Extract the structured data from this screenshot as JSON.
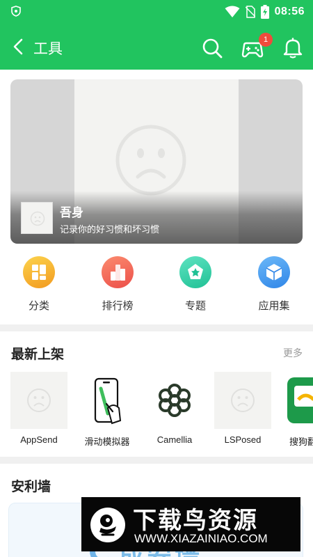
{
  "status_bar": {
    "time": "08:56",
    "icons": [
      "shield-icon",
      "wifi-icon",
      "no-sim-icon",
      "battery-charging-icon"
    ]
  },
  "app_bar": {
    "title": "工具",
    "icons": [
      "back-arrow-icon",
      "search-icon",
      "gamepad-icon",
      "bell-icon"
    ],
    "notification_count": "1"
  },
  "colors": {
    "brand_green": "#21c45f",
    "badge_red": "#ef4b3c"
  },
  "banner": {
    "app_name": "吾身",
    "description": "记录你的好习惯和坏习惯"
  },
  "quick_nav": {
    "items": [
      {
        "label": "分类",
        "icon": "category-icon",
        "color": "#f5b12c"
      },
      {
        "label": "排行榜",
        "icon": "ranking-icon",
        "color": "#f2665a"
      },
      {
        "label": "专题",
        "icon": "topic-star-icon",
        "color": "#2fcfa5"
      },
      {
        "label": "应用集",
        "icon": "collection-cube-icon",
        "color": "#3d9af0"
      }
    ]
  },
  "newest": {
    "title": "最新上架",
    "more_label": "更多",
    "apps": [
      {
        "name": "AppSend",
        "icon": "placeholder-sad-icon"
      },
      {
        "name": "滑动模拟器",
        "icon": "phone-swipe-icon"
      },
      {
        "name": "Camellia",
        "icon": "camellia-flower-icon"
      },
      {
        "name": "LSPosed",
        "icon": "placeholder-sad-icon"
      },
      {
        "name": "搜狗翻",
        "icon": "sogou-icon"
      }
    ]
  },
  "wall": {
    "title": "安利墙",
    "card_text": "成安墙"
  },
  "watermark": {
    "title": "下载鸟资源",
    "url": "WWW.XIAZAINIAO.COM"
  }
}
